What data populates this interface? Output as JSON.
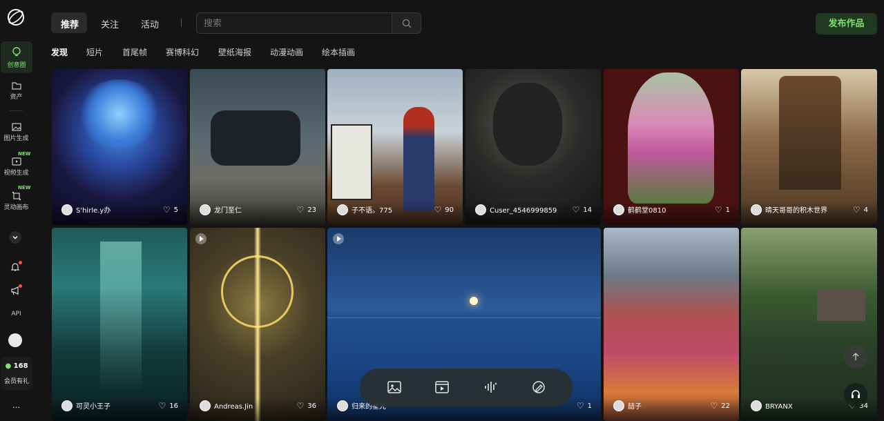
{
  "rail": {
    "items": [
      {
        "label": "创意圈",
        "icon": "bulb-icon"
      },
      {
        "label": "资产",
        "icon": "folder-icon"
      },
      {
        "label": "图片生成",
        "icon": "image-icon"
      },
      {
        "label": "视频生成",
        "icon": "video-icon",
        "badge": "NEW"
      },
      {
        "label": "灵动画布",
        "icon": "canvas-icon",
        "badge": "NEW"
      }
    ],
    "api_label": "API",
    "points": "168",
    "member_label": "会员有礼",
    "more_label": "..."
  },
  "header": {
    "tabs": [
      {
        "label": "推荐",
        "active": true
      },
      {
        "label": "关注"
      },
      {
        "label": "活动"
      }
    ],
    "search_placeholder": "搜索",
    "publish_label": "发布作品"
  },
  "categories": [
    {
      "label": "发现",
      "active": true
    },
    {
      "label": "短片"
    },
    {
      "label": "首尾帧"
    },
    {
      "label": "赛博科幻"
    },
    {
      "label": "壁纸海报"
    },
    {
      "label": "动漫动画"
    },
    {
      "label": "绘本插画"
    }
  ],
  "cards": [
    {
      "user": "S'hirle.y办",
      "likes": "5"
    },
    {
      "user": "龙门至仁",
      "likes": "23"
    },
    {
      "user": "子不语。775",
      "likes": "90"
    },
    {
      "user": "Cuser_4546999859",
      "likes": "14"
    },
    {
      "user": "鹤鹤堂0810",
      "likes": "1"
    },
    {
      "user": "晴天哥哥的积木世界",
      "likes": "4"
    },
    {
      "user": "可灵小王子",
      "likes": "16"
    },
    {
      "user": "Andreas.Jin",
      "likes": "36"
    },
    {
      "user": "归来的星光",
      "likes": "1"
    },
    {
      "user": "喆子",
      "likes": "22"
    },
    {
      "user": "BRYANX",
      "likes": "34"
    }
  ],
  "colors": {
    "accent": "#7fe36f",
    "background": "#141414",
    "publish_bg": "#1f3a20"
  }
}
